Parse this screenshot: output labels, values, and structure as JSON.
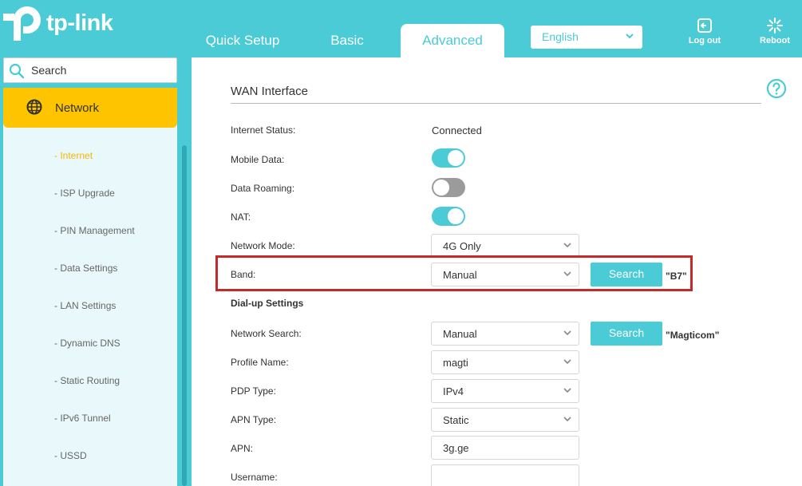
{
  "brand": {
    "name": "tp-link",
    "accent": "#4acbd6",
    "highlight": "#ffc400"
  },
  "nav_tabs": [
    {
      "label": "Quick Setup"
    },
    {
      "label": "Basic"
    },
    {
      "label": "Advanced",
      "active": true
    }
  ],
  "language": {
    "selected": "English"
  },
  "header_buttons": {
    "logout": "Log out",
    "reboot": "Reboot"
  },
  "sidebar": {
    "search_placeholder": "Search",
    "section": "Network",
    "items": [
      {
        "label": "- Internet",
        "active": true
      },
      {
        "label": "- ISP Upgrade"
      },
      {
        "label": "- PIN Management"
      },
      {
        "label": "- Data Settings"
      },
      {
        "label": "- LAN Settings"
      },
      {
        "label": "- Dynamic DNS"
      },
      {
        "label": "- Static Routing"
      },
      {
        "label": "- IPv6 Tunnel"
      },
      {
        "label": "- USSD"
      }
    ]
  },
  "main": {
    "title": "WAN Interface",
    "internet_status": {
      "label": "Internet Status:",
      "value": "Connected"
    },
    "mobile_data": {
      "label": "Mobile Data:",
      "on": true
    },
    "data_roaming": {
      "label": "Data Roaming:",
      "on": false
    },
    "nat": {
      "label": "NAT:",
      "on": true
    },
    "network_mode": {
      "label": "Network Mode:",
      "value": "4G Only"
    },
    "band": {
      "label": "Band:",
      "value": "Manual",
      "button": "Search",
      "annotation": "\"B7\""
    },
    "dialup_heading": "Dial-up Settings",
    "network_search": {
      "label": "Network Search:",
      "value": "Manual",
      "button": "Search",
      "annotation": "\"Magticom\""
    },
    "profile_name": {
      "label": "Profile Name:",
      "value": "magti"
    },
    "pdp_type": {
      "label": "PDP Type:",
      "value": "IPv4"
    },
    "apn_type": {
      "label": "APN Type:",
      "value": "Static"
    },
    "apn": {
      "label": "APN:",
      "value": "3g.ge"
    },
    "username": {
      "label": "Username:",
      "value": ""
    }
  }
}
